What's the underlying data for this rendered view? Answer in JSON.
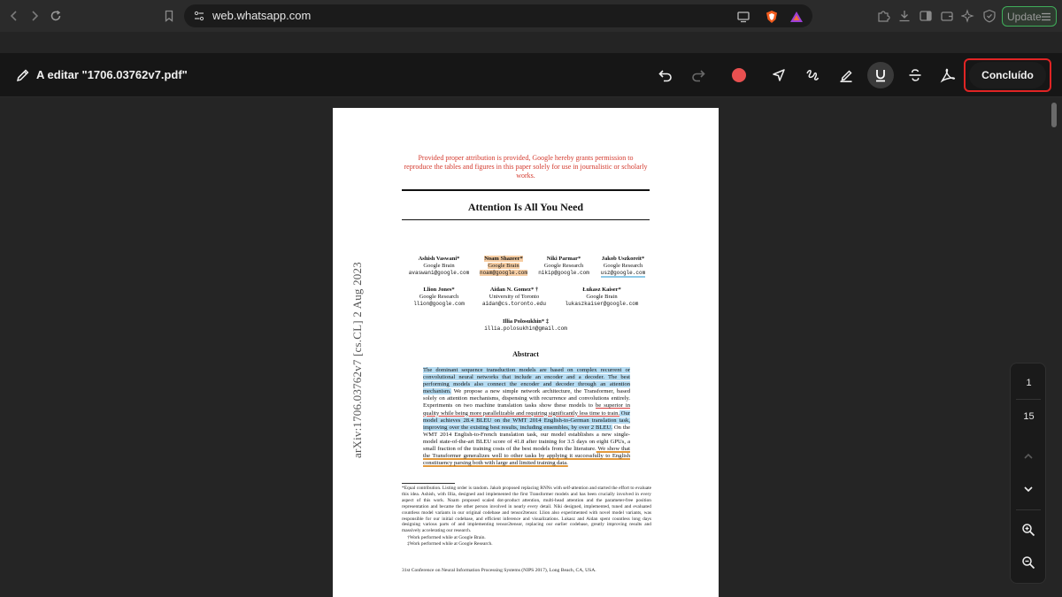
{
  "browser": {
    "url": "web.whatsapp.com",
    "update_label": "Update",
    "icons": [
      "back-icon",
      "forward-icon",
      "reload-icon",
      "bookmark-icon",
      "site-settings-icon",
      "cast-icon",
      "brave-shield-icon",
      "brave-rewards-icon",
      "extensions-icon",
      "downloads-icon",
      "sidebar-icon",
      "wallet-icon",
      "leo-ai-icon",
      "vpn-icon",
      "menu-icon"
    ]
  },
  "editor": {
    "title": "A editar \"1706.03762v7.pdf\"",
    "done_label": "Concluído",
    "pen_color": "#e85050",
    "highlight_color": "#e02424",
    "tools": [
      "undo-icon",
      "redo-icon",
      "color-dot",
      "send-icon",
      "draw-icon",
      "highlighter-icon",
      "underline-icon",
      "strikethrough-icon",
      "acrobat-icon"
    ]
  },
  "pdf": {
    "permission": "Provided proper attribution is provided, Google hereby grants permission to reproduce the tables and figures in this paper solely for use in journalistic or scholarly works.",
    "title": "Attention Is All You Need",
    "arxiv_id": "arXiv:1706.03762v7  [cs.CL]  2 Aug 2023",
    "authors": [
      {
        "name": "Ashish Vaswani*",
        "affil": "Google Brain",
        "email": "avaswani@google.com"
      },
      {
        "name": "Noam Shazeer*",
        "affil": "Google Brain",
        "email": "noam@google.com"
      },
      {
        "name": "Niki Parmar*",
        "affil": "Google Research",
        "email": "nikip@google.com"
      },
      {
        "name": "Jakob Uszkoreit*",
        "affil": "Google Research",
        "email": "usz@google.com"
      },
      {
        "name": "Llion Jones*",
        "affil": "Google Research",
        "email": "llion@google.com"
      },
      {
        "name": "Aidan N. Gomez* †",
        "affil": "University of Toronto",
        "email": "aidan@cs.toronto.edu"
      },
      {
        "name": "Łukasz Kaiser*",
        "affil": "Google Brain",
        "email": "lukaszkaiser@google.com"
      },
      {
        "name": "Illia Polosukhin* ‡",
        "affil": "",
        "email": "illia.polosukhin@gmail.com"
      }
    ],
    "abstract_title": "Abstract",
    "abstract": {
      "p1": "The dominant sequence transduction models are based on complex recurrent or convolutional neural networks that include an encoder and a decoder. The best performing models also connect the encoder and decoder through an attention mechanism.",
      "p2": " We propose a new simple network architecture, the Transformer, based solely on attention mechanisms, dispensing with recurrence and convolutions entirely. Experiments on two machine translation tasks show these models to ",
      "p3": "be superior in quality while being more parallelizable and requiring significantly less time to train.",
      "p4": " Our model achieves 28.4 BLEU on the WMT 2014 English-to-German translation task, improving over the existing best results, including ensembles, by over 2 BLEU.",
      "p5": " On the WMT 2014 English-to-French translation task, our model establishes a new single-model state-of-the-art BLEU score of 41.8 after training for 3.5 days on eight GPUs, a small fraction of the training costs of the best models from the literature.",
      "p6": " We show that the Transformer generalizes well to other tasks by applying it successfully to English constituency parsing both with large and limited training data."
    },
    "footnote_main": "*Equal contribution. Listing order is random. Jakob proposed replacing RNNs with self-attention and started the effort to evaluate this idea. Ashish, with Illia, designed and implemented the first Transformer models and has been crucially involved in every aspect of this work. Noam proposed scaled dot-product attention, multi-head attention and the parameter-free position representation and became the other person involved in nearly every detail. Niki designed, implemented, tuned and evaluated countless model variants in our original codebase and tensor2tensor. Llion also experimented with novel model variants, was responsible for our initial codebase, and efficient inference and visualizations. Lukasz and Aidan spent countless long days designing various parts of and implementing tensor2tensor, replacing our earlier codebase, greatly improving results and massively accelerating our research.",
    "footnote_dagger": "†Work performed while at Google Brain.",
    "footnote_ddagger": "‡Work performed while at Google Research.",
    "conference": "31st Conference on Neural Information Processing Systems (NIPS 2017), Long Beach, CA, USA."
  },
  "pager": {
    "current_page": "1",
    "total_pages": "15"
  }
}
